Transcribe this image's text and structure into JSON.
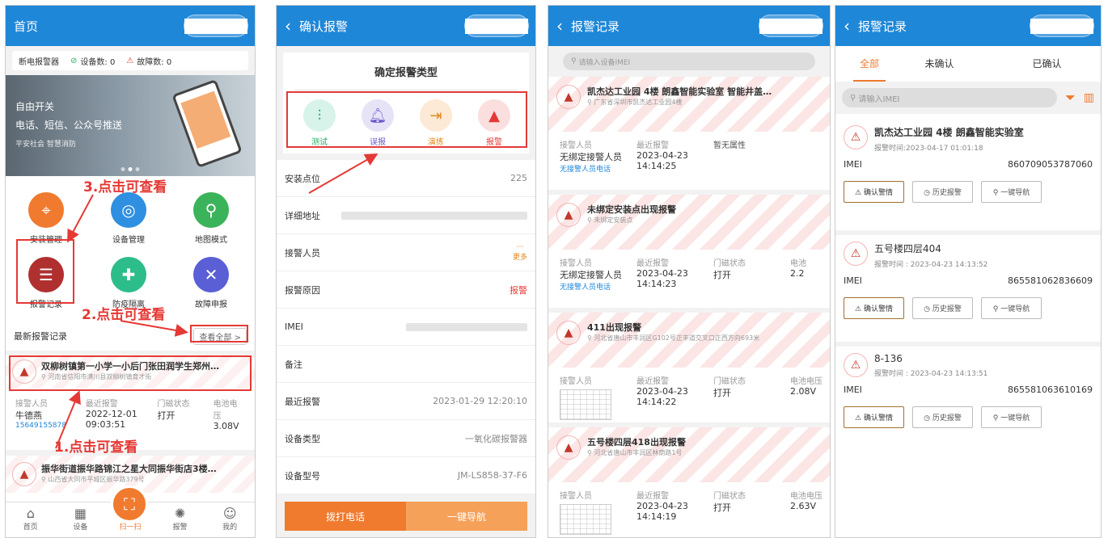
{
  "s1": {
    "title": "首页",
    "status": {
      "device_name": "断电报警器",
      "device_count": "设备数: 0",
      "fault_count": "故障数: 0"
    },
    "banner": {
      "line1": "自由开关",
      "line2": "电话、短信、公众号推送",
      "line3": "平安社会 智慧消防"
    },
    "grid": [
      {
        "label": "安装管理",
        "icon": "map-pin-icon"
      },
      {
        "label": "设备管理",
        "icon": "device-icon"
      },
      {
        "label": "地图模式",
        "icon": "map-icon"
      },
      {
        "label": "报警记录",
        "icon": "alarm-record-icon"
      },
      {
        "label": "防疫隔离",
        "icon": "quarantine-icon"
      },
      {
        "label": "故障申报",
        "icon": "tools-icon"
      }
    ],
    "section_title": "最新报警记录",
    "view_all": "查看全部 >",
    "card1": {
      "title": "双柳树镇第一小学一小后门张田润学生郑州…",
      "address": "河南省信阳市潢川县双柳树镇育才街",
      "h1": "接警人员",
      "h2": "最近报警",
      "h3": "门磁状态",
      "h4": "电池电压",
      "v1": "牛德燕",
      "v2a": "2022-12-01",
      "v2b": "09:03:51",
      "v3": "打开",
      "v4": "3.08V",
      "phone": "15649155878"
    },
    "card2": {
      "title": "振华街道振华路锦江之星大同振华街店3楼…",
      "address": "山西省大同市平城区振华路379号"
    },
    "tabbar": [
      "首页",
      "设备",
      "扫一扫",
      "报警",
      "我的"
    ],
    "annotations": [
      "3.点击可查看",
      "2.点击可查看",
      "1.点击可查看"
    ]
  },
  "s2": {
    "title": "确认报警",
    "card_title": "确定报警类型",
    "types": [
      "测试",
      "误报",
      "演练",
      "报警"
    ],
    "fields": [
      {
        "label": "安装点位",
        "value": "225"
      },
      {
        "label": "详细地址",
        "value": ""
      },
      {
        "label": "接警人员",
        "value": ""
      },
      {
        "label": "报警原因",
        "value": "报警"
      },
      {
        "label": "IMEI",
        "value": ""
      },
      {
        "label": "备注",
        "value": ""
      },
      {
        "label": "最近报警",
        "value": "2023-01-29 12:20:10"
      },
      {
        "label": "设备类型",
        "value": "一氧化碳报警器"
      },
      {
        "label": "设备型号",
        "value": "JM-LS858-37-F6"
      }
    ],
    "more": "更多",
    "btn_call": "拨打电话",
    "btn_nav": "一键导航"
  },
  "s3": {
    "title": "报警记录",
    "search_placeholder": "请输入设备IMEI",
    "records": [
      {
        "title": "凯杰达工业园 4楼 朗鑫智能实验室 智能井盖…",
        "address": "广东省深圳市凯杰达工业园4楼",
        "h1": "接警人员",
        "h2": "最近报警",
        "h3": "暂无属性",
        "h4": "",
        "v1": "无绑定接警人员",
        "v2a": "2023-04-23",
        "v2b": "14:14:25",
        "v3": "",
        "v4": "",
        "phone": "无接警人员电话"
      },
      {
        "title": "未绑定安装点出现报警",
        "address": "未绑定安装点",
        "h1": "接警人员",
        "h2": "最近报警",
        "h3": "门磁状态",
        "h4": "电池",
        "v1": "无绑定接警人员",
        "v2a": "2023-04-23",
        "v2b": "14:14:23",
        "v3": "打开",
        "v4": "2.2",
        "phone": "无接警人员电话"
      },
      {
        "title": "411出现报警",
        "address": "河北省唐山市丰润区G102号正丰道交叉口正西方向693米",
        "h1": "接警人员",
        "h2": "最近报警",
        "h3": "门磁状态",
        "h4": "电池电压",
        "v1": "",
        "v2a": "2023-04-23",
        "v2b": "14:14:22",
        "v3": "打开",
        "v4": "2.08V",
        "phone": ""
      },
      {
        "title": "五号楼四层418出现报警",
        "address": "河北省唐山市丰润区林荫路1号",
        "h1": "接警人员",
        "h2": "最近报警",
        "h3": "门磁状态",
        "h4": "电池电压",
        "v1": "",
        "v2a": "2023-04-23",
        "v2b": "14:14:19",
        "v3": "打开",
        "v4": "2.63V",
        "phone": ""
      }
    ]
  },
  "s4": {
    "title": "报警记录",
    "tabs": [
      "全部",
      "未确认",
      "已确认"
    ],
    "search_placeholder": "请输入IMEI",
    "records": [
      {
        "title": "凯杰达工业园 4楼 朗鑫智能实验室",
        "time": "报警时间:2023-04-17 01:01:18",
        "imei_label": "IMEI",
        "imei": "860709053787060"
      },
      {
        "title": "五号楼四层404",
        "time": "报警时间 : 2023-04-23 14:13:52",
        "imei_label": "IMEI",
        "imei": "865581062836609"
      },
      {
        "title": "8-136",
        "time": "报警时间 : 2023-04-23 14:13:51",
        "imei_label": "IMEI",
        "imei": "865581063610169"
      }
    ],
    "btn_confirm": "确认警情",
    "btn_history": "历史报警",
    "btn_nav": "一键导航"
  }
}
